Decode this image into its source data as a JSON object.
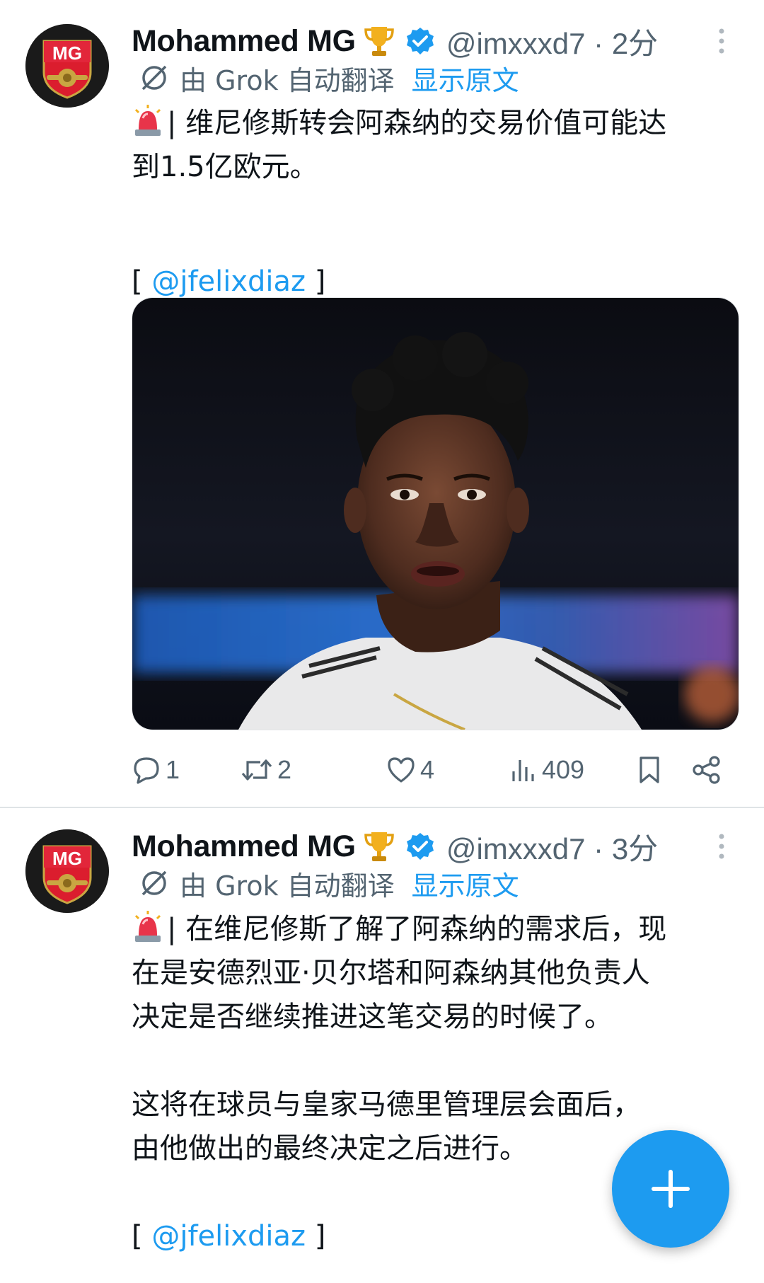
{
  "colors": {
    "accent": "#1d9bf0",
    "muted": "#536471",
    "text": "#0f1419"
  },
  "tweets": [
    {
      "avatar_icon": "arsenal-mg-logo",
      "display_name": "Mohammed MG",
      "badge_icon": "trophy-icon",
      "verified_icon": "verified-badge-icon",
      "handle_time": "@imxxxd7 · 2分",
      "translate": {
        "icon": "grok-icon",
        "label": "由 Grok 自动翻译",
        "show_original": "显示原文"
      },
      "text_lines": [
        "| 维尼修斯转会阿森纳的交易价值可能达",
        "到1.5亿欧元。"
      ],
      "source_open": "[ ",
      "mention": "@jfelixdiaz",
      "source_close": " ]",
      "media_description_icon": "player-photo",
      "actions": {
        "replies": "1",
        "retweets": "2",
        "likes": "4",
        "views": "409"
      }
    },
    {
      "avatar_icon": "arsenal-mg-logo",
      "display_name": "Mohammed MG",
      "badge_icon": "trophy-icon",
      "verified_icon": "verified-badge-icon",
      "handle_time": "@imxxxd7 · 3分",
      "translate": {
        "icon": "grok-icon",
        "label": "由 Grok 自动翻译",
        "show_original": "显示原文"
      },
      "text_lines": [
        "| 在维尼修斯了解了阿森纳的需求后，现",
        "在是安德烈亚·贝尔塔和阿森纳其他负责人",
        "决定是否继续推进这笔交易的时候了。"
      ],
      "text_lines_2": [
        "这将在球员与皇家马德里管理层会面后，",
        "由他做出的最终决定之后进行。"
      ],
      "source_open": "[ ",
      "mention": "@jfelixdiaz",
      "source_close": " ]"
    }
  ],
  "fab": {
    "icon": "plus-icon"
  }
}
